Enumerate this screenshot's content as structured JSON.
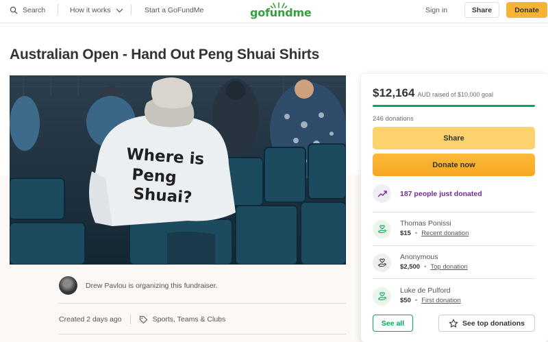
{
  "header": {
    "search_label": "Search",
    "how_it_works_label": "How it works",
    "start_label": "Start a GoFundMe",
    "logo_text": "gofundme",
    "sign_in_label": "Sign in",
    "share_label": "Share",
    "donate_label": "Donate"
  },
  "campaign": {
    "title": "Australian Open - Hand Out Peng Shuai Shirts",
    "image_shirt_text": [
      "Where is",
      "Peng",
      "Shuai?"
    ],
    "organizer_text": "Drew Pavlou is organizing this fundraiser.",
    "created": "Created 2 days ago",
    "category": "Sports, Teams & Clubs"
  },
  "sidebar": {
    "raised_amount": "$12,164",
    "raised_goal_text": "AUD raised of $10,000 goal",
    "progress_percent": 100,
    "donations_count": "246 donations",
    "share_label": "Share",
    "donate_now_label": "Donate now",
    "trend_text": "187 people just donated",
    "donors": [
      {
        "name": "Thomas Ponissi",
        "amount": "$15",
        "tag": "Recent donation"
      },
      {
        "name": "Anonymous",
        "amount": "$2,500",
        "tag": "Top donation"
      },
      {
        "name": "Luke de Pulford",
        "amount": "$50",
        "tag": "First donation"
      }
    ],
    "see_all_label": "See all",
    "see_top_label": "See top donations"
  },
  "colors": {
    "brand_green": "#02a95c",
    "donate_orange": "#f6b335",
    "trend_purple": "#6e2c93"
  },
  "icons": [
    "search-icon",
    "chevron-down-icon",
    "trending-up-icon",
    "donor-hand-icon",
    "star-icon",
    "tag-icon"
  ]
}
